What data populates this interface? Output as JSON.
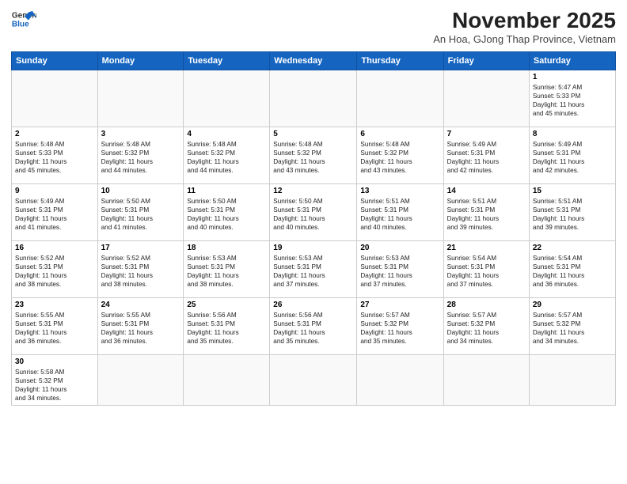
{
  "header": {
    "logo_line1": "General",
    "logo_line2": "Blue",
    "month": "November 2025",
    "location": "An Hoa, GJong Thap Province, Vietnam"
  },
  "weekdays": [
    "Sunday",
    "Monday",
    "Tuesday",
    "Wednesday",
    "Thursday",
    "Friday",
    "Saturday"
  ],
  "weeks": [
    [
      {
        "day": "",
        "info": ""
      },
      {
        "day": "",
        "info": ""
      },
      {
        "day": "",
        "info": ""
      },
      {
        "day": "",
        "info": ""
      },
      {
        "day": "",
        "info": ""
      },
      {
        "day": "",
        "info": ""
      },
      {
        "day": "1",
        "info": "Sunrise: 5:47 AM\nSunset: 5:33 PM\nDaylight: 11 hours\nand 45 minutes."
      }
    ],
    [
      {
        "day": "2",
        "info": "Sunrise: 5:48 AM\nSunset: 5:33 PM\nDaylight: 11 hours\nand 45 minutes."
      },
      {
        "day": "3",
        "info": "Sunrise: 5:48 AM\nSunset: 5:32 PM\nDaylight: 11 hours\nand 44 minutes."
      },
      {
        "day": "4",
        "info": "Sunrise: 5:48 AM\nSunset: 5:32 PM\nDaylight: 11 hours\nand 44 minutes."
      },
      {
        "day": "5",
        "info": "Sunrise: 5:48 AM\nSunset: 5:32 PM\nDaylight: 11 hours\nand 43 minutes."
      },
      {
        "day": "6",
        "info": "Sunrise: 5:48 AM\nSunset: 5:32 PM\nDaylight: 11 hours\nand 43 minutes."
      },
      {
        "day": "7",
        "info": "Sunrise: 5:49 AM\nSunset: 5:31 PM\nDaylight: 11 hours\nand 42 minutes."
      },
      {
        "day": "8",
        "info": "Sunrise: 5:49 AM\nSunset: 5:31 PM\nDaylight: 11 hours\nand 42 minutes."
      }
    ],
    [
      {
        "day": "9",
        "info": "Sunrise: 5:49 AM\nSunset: 5:31 PM\nDaylight: 11 hours\nand 41 minutes."
      },
      {
        "day": "10",
        "info": "Sunrise: 5:50 AM\nSunset: 5:31 PM\nDaylight: 11 hours\nand 41 minutes."
      },
      {
        "day": "11",
        "info": "Sunrise: 5:50 AM\nSunset: 5:31 PM\nDaylight: 11 hours\nand 40 minutes."
      },
      {
        "day": "12",
        "info": "Sunrise: 5:50 AM\nSunset: 5:31 PM\nDaylight: 11 hours\nand 40 minutes."
      },
      {
        "day": "13",
        "info": "Sunrise: 5:51 AM\nSunset: 5:31 PM\nDaylight: 11 hours\nand 40 minutes."
      },
      {
        "day": "14",
        "info": "Sunrise: 5:51 AM\nSunset: 5:31 PM\nDaylight: 11 hours\nand 39 minutes."
      },
      {
        "day": "15",
        "info": "Sunrise: 5:51 AM\nSunset: 5:31 PM\nDaylight: 11 hours\nand 39 minutes."
      }
    ],
    [
      {
        "day": "16",
        "info": "Sunrise: 5:52 AM\nSunset: 5:31 PM\nDaylight: 11 hours\nand 38 minutes."
      },
      {
        "day": "17",
        "info": "Sunrise: 5:52 AM\nSunset: 5:31 PM\nDaylight: 11 hours\nand 38 minutes."
      },
      {
        "day": "18",
        "info": "Sunrise: 5:53 AM\nSunset: 5:31 PM\nDaylight: 11 hours\nand 38 minutes."
      },
      {
        "day": "19",
        "info": "Sunrise: 5:53 AM\nSunset: 5:31 PM\nDaylight: 11 hours\nand 37 minutes."
      },
      {
        "day": "20",
        "info": "Sunrise: 5:53 AM\nSunset: 5:31 PM\nDaylight: 11 hours\nand 37 minutes."
      },
      {
        "day": "21",
        "info": "Sunrise: 5:54 AM\nSunset: 5:31 PM\nDaylight: 11 hours\nand 37 minutes."
      },
      {
        "day": "22",
        "info": "Sunrise: 5:54 AM\nSunset: 5:31 PM\nDaylight: 11 hours\nand 36 minutes."
      }
    ],
    [
      {
        "day": "23",
        "info": "Sunrise: 5:55 AM\nSunset: 5:31 PM\nDaylight: 11 hours\nand 36 minutes."
      },
      {
        "day": "24",
        "info": "Sunrise: 5:55 AM\nSunset: 5:31 PM\nDaylight: 11 hours\nand 36 minutes."
      },
      {
        "day": "25",
        "info": "Sunrise: 5:56 AM\nSunset: 5:31 PM\nDaylight: 11 hours\nand 35 minutes."
      },
      {
        "day": "26",
        "info": "Sunrise: 5:56 AM\nSunset: 5:31 PM\nDaylight: 11 hours\nand 35 minutes."
      },
      {
        "day": "27",
        "info": "Sunrise: 5:57 AM\nSunset: 5:32 PM\nDaylight: 11 hours\nand 35 minutes."
      },
      {
        "day": "28",
        "info": "Sunrise: 5:57 AM\nSunset: 5:32 PM\nDaylight: 11 hours\nand 34 minutes."
      },
      {
        "day": "29",
        "info": "Sunrise: 5:57 AM\nSunset: 5:32 PM\nDaylight: 11 hours\nand 34 minutes."
      }
    ],
    [
      {
        "day": "30",
        "info": "Sunrise: 5:58 AM\nSunset: 5:32 PM\nDaylight: 11 hours\nand 34 minutes."
      },
      {
        "day": "",
        "info": ""
      },
      {
        "day": "",
        "info": ""
      },
      {
        "day": "",
        "info": ""
      },
      {
        "day": "",
        "info": ""
      },
      {
        "day": "",
        "info": ""
      },
      {
        "day": "",
        "info": ""
      }
    ]
  ]
}
